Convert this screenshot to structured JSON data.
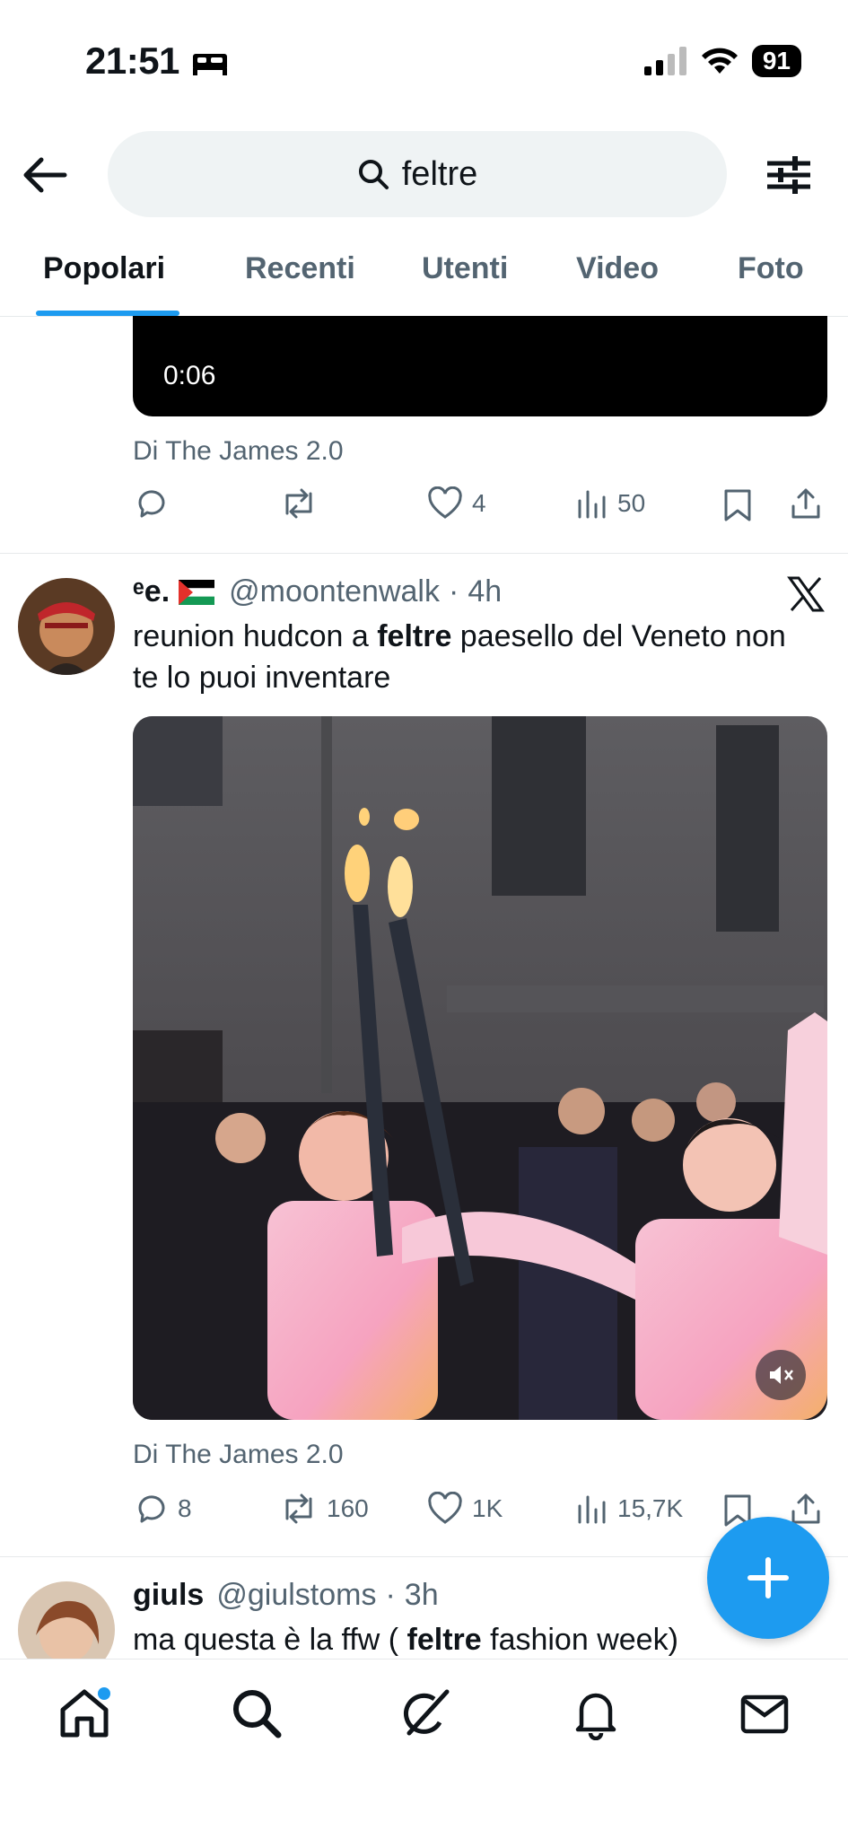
{
  "status_bar": {
    "time": "21:51",
    "battery": "91"
  },
  "search": {
    "query": "feltre"
  },
  "tabs": [
    {
      "label": "Popolari",
      "active": true
    },
    {
      "label": "Recenti",
      "active": false
    },
    {
      "label": "Utenti",
      "active": false
    },
    {
      "label": "Video",
      "active": false
    },
    {
      "label": "Foto",
      "active": false
    }
  ],
  "tweet1": {
    "video_duration": "0:06",
    "source": "Di The James 2.0",
    "likes": "4",
    "views": "50"
  },
  "tweet2": {
    "display_name": "ᵉe.",
    "handle": "@moontenwalk",
    "time": "4h",
    "text_before": "reunion hudcon a ",
    "text_bold": "feltre",
    "text_after": " paesello del Veneto non te lo puoi inventare",
    "source": "Di The James 2.0",
    "replies": "8",
    "retweets": "160",
    "likes": "1K",
    "views": "15,7K"
  },
  "tweet3": {
    "display_name": "giuls",
    "handle": "@giulstoms",
    "time": "3h",
    "text_before": "ma questa è la ffw ( ",
    "text_bold": "feltre",
    "text_after": " fashion week)"
  },
  "colors": {
    "accent": "#1d9bf0",
    "text": "#0f1419",
    "secondary": "#536471"
  },
  "icons": [
    "back-arrow-icon",
    "search-icon",
    "filter-icon",
    "reply-icon",
    "retweet-icon",
    "like-icon",
    "views-icon",
    "bookmark-icon",
    "share-icon",
    "x-logo-icon",
    "mute-icon",
    "compose-icon",
    "home-icon",
    "explore-icon",
    "grok-icon",
    "notifications-icon",
    "messages-icon"
  ]
}
